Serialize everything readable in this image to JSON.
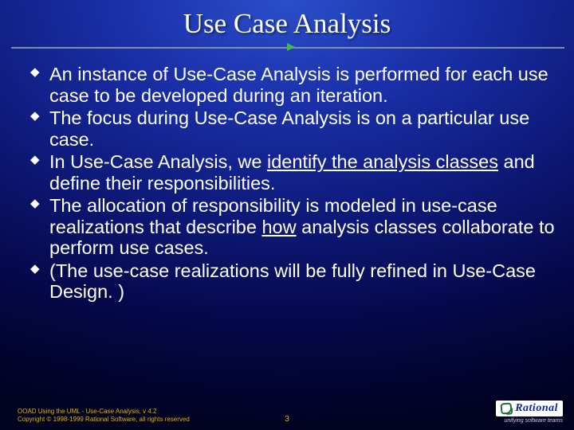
{
  "title": "Use Case Analysis",
  "bullets": [
    {
      "segments": [
        {
          "text": "An instance of Use-Case Analysis is performed for each use case to be developed during an iteration."
        }
      ]
    },
    {
      "segments": [
        {
          "text": "The focus during Use-Case Analysis is on a particular use case."
        }
      ]
    },
    {
      "segments": [
        {
          "text": "In Use-Case Analysis, we "
        },
        {
          "text": "identify the analysis classes",
          "underline": true
        },
        {
          "text": " and define their responsibilities."
        }
      ]
    },
    {
      "segments": [
        {
          "text": "The allocation of responsibility is modeled in use-case realizations that describe "
        },
        {
          "text": "how",
          "underline": true
        },
        {
          "text": " analysis classes collaborate to perform use cases."
        }
      ]
    },
    {
      "segments": [
        {
          "text": "(The use-case realizations will be fully refined in Use-Case Design. )"
        }
      ]
    }
  ],
  "footer": {
    "line1": "OOAD Using the UML - Use-Case Analysis, v 4.2",
    "line2": "Copyright © 1998-1999 Rational Software, all rights reserved",
    "page": "3",
    "logo_text": "Rational",
    "tagline": "unifying software teams"
  }
}
